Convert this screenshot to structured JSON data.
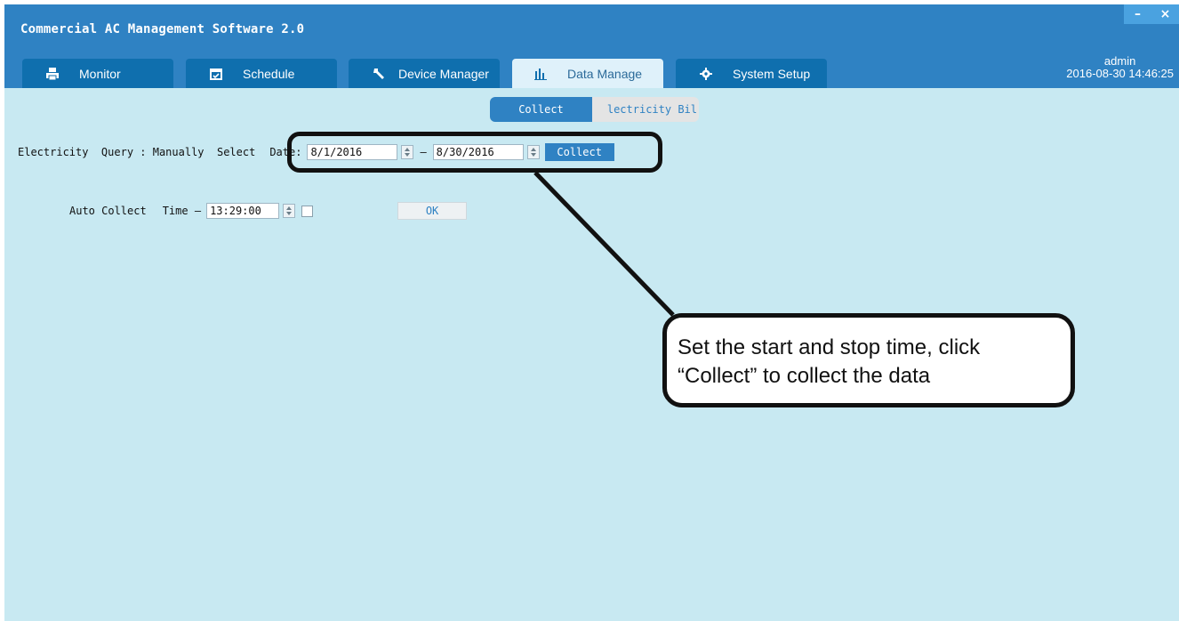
{
  "window": {
    "title": "Commercial AC Management Software 2.0",
    "minimize_label": "–",
    "close_label": "×"
  },
  "tabs": [
    {
      "label": "Monitor",
      "icon": "printer-icon"
    },
    {
      "label": "Schedule",
      "icon": "calendar-icon"
    },
    {
      "label": "Device Manager",
      "icon": "wrench-icon"
    },
    {
      "label": "Data Manage",
      "icon": "bar-chart-icon",
      "active": true
    },
    {
      "label": "System Setup",
      "icon": "gear-icon"
    }
  ],
  "user": {
    "name": "admin",
    "datetime": "2016-08-30 14:46:25"
  },
  "subtabs": {
    "collect": "Collect",
    "bill": "lectricity Bil"
  },
  "manual": {
    "label": "Electricity  Query : Manually  Select",
    "date_label": "Date:",
    "start_date": "8/1/2016",
    "separator": "–",
    "end_date": "8/30/2016",
    "collect_button": "Collect"
  },
  "auto": {
    "label": "Auto Collect",
    "time_label": "Time –",
    "time_value": "13:29:00",
    "enabled": false,
    "ok_button": "OK"
  },
  "callout": {
    "text_line1": "Set the start and stop time, click",
    "text_line2": "“Collect” to collect the data"
  },
  "colors": {
    "titlebar": "#2f82c3",
    "tab": "#0f6fae",
    "active_tab": "#dff1fa",
    "content_bg": "#c8e9f2"
  }
}
